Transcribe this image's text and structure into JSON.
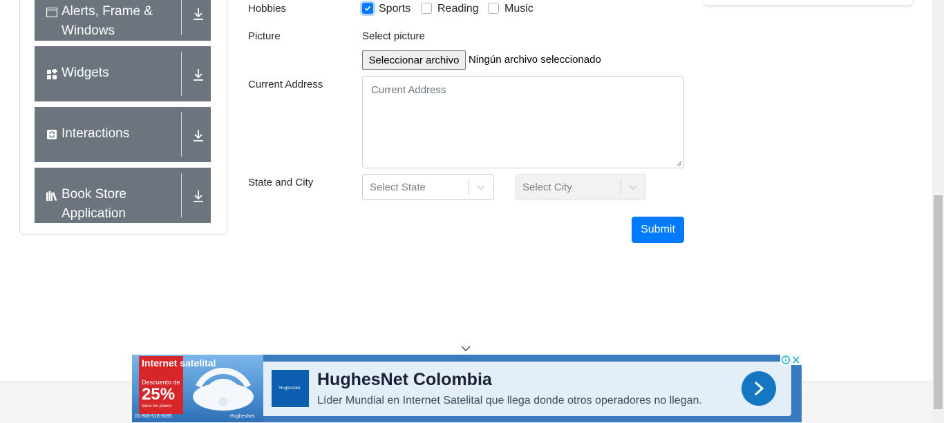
{
  "sidebar": {
    "groups": [
      {
        "label": "Alerts, Frame & Windows",
        "icon": "window-icon"
      },
      {
        "label": "Widgets",
        "icon": "widgets-icon"
      },
      {
        "label": "Interactions",
        "icon": "interactions-icon"
      },
      {
        "label": "Book Store Application",
        "icon": "book-icon"
      }
    ]
  },
  "form": {
    "hobbies_label": "Hobbies",
    "hobbies": [
      {
        "label": "Sports",
        "checked": true
      },
      {
        "label": "Reading",
        "checked": false
      },
      {
        "label": "Music",
        "checked": false
      }
    ],
    "picture_label": "Picture",
    "picture_prompt": "Select picture",
    "file_button": "Seleccionar archivo",
    "file_status": "Ningún archivo seleccionado",
    "address_label": "Current Address",
    "address_placeholder": "Current Address",
    "state_city_label": "State and City",
    "state_placeholder": "Select State",
    "city_placeholder": "Select City",
    "submit_label": "Submit"
  },
  "ad": {
    "promo_title": "Internet satelital",
    "promo_discount_label": "Descuento de",
    "promo_discount": "25%",
    "promo_note": "todos los planes",
    "promo_phone": "01-800-518-9185",
    "promo_brand": "HughesNet.",
    "logo_text": "HughesNet.",
    "title": "HughesNet Colombia",
    "description": "Líder Mundial en Internet Satelital que llega donde otros operadores no llegan."
  },
  "colors": {
    "sidebar_group": "#6c757d",
    "primary": "#007bff",
    "ad_cta": "#1577c1"
  }
}
